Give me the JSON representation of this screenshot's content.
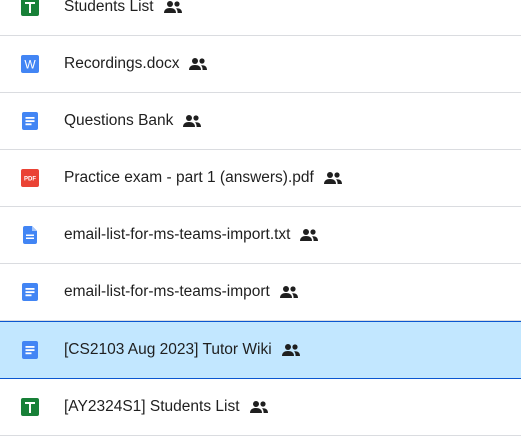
{
  "files": [
    {
      "name": "Students List",
      "type": "sheets",
      "icon": "google-sheets-icon",
      "shared": true,
      "selected": false
    },
    {
      "name": "Recordings.docx",
      "type": "word",
      "icon": "word-doc-icon",
      "shared": true,
      "selected": false
    },
    {
      "name": "Questions Bank",
      "type": "docs",
      "icon": "google-docs-icon",
      "shared": true,
      "selected": false
    },
    {
      "name": "Practice exam - part 1 (answers).pdf",
      "type": "pdf",
      "icon": "pdf-icon",
      "shared": true,
      "selected": false
    },
    {
      "name": "email-list-for-ms-teams-import.txt",
      "type": "txt",
      "icon": "text-file-icon",
      "shared": true,
      "selected": false
    },
    {
      "name": "email-list-for-ms-teams-import",
      "type": "docs",
      "icon": "google-docs-icon",
      "shared": true,
      "selected": false
    },
    {
      "name": "[CS2103 Aug 2023] Tutor Wiki",
      "type": "docs",
      "icon": "google-docs-icon",
      "shared": true,
      "selected": true
    },
    {
      "name": "[AY2324S1] Students List",
      "type": "sheets",
      "icon": "google-sheets-icon",
      "shared": true,
      "selected": false
    }
  ],
  "icon_labels": {
    "word": "W",
    "pdf": "PDF"
  },
  "colors": {
    "sheets": "#188038",
    "docs": "#4285f4",
    "word": "#4285f4",
    "pdf": "#ea4335",
    "txt": "#4285f4",
    "selected_bg": "#c2e7ff",
    "selected_border": "#0b57d0"
  }
}
